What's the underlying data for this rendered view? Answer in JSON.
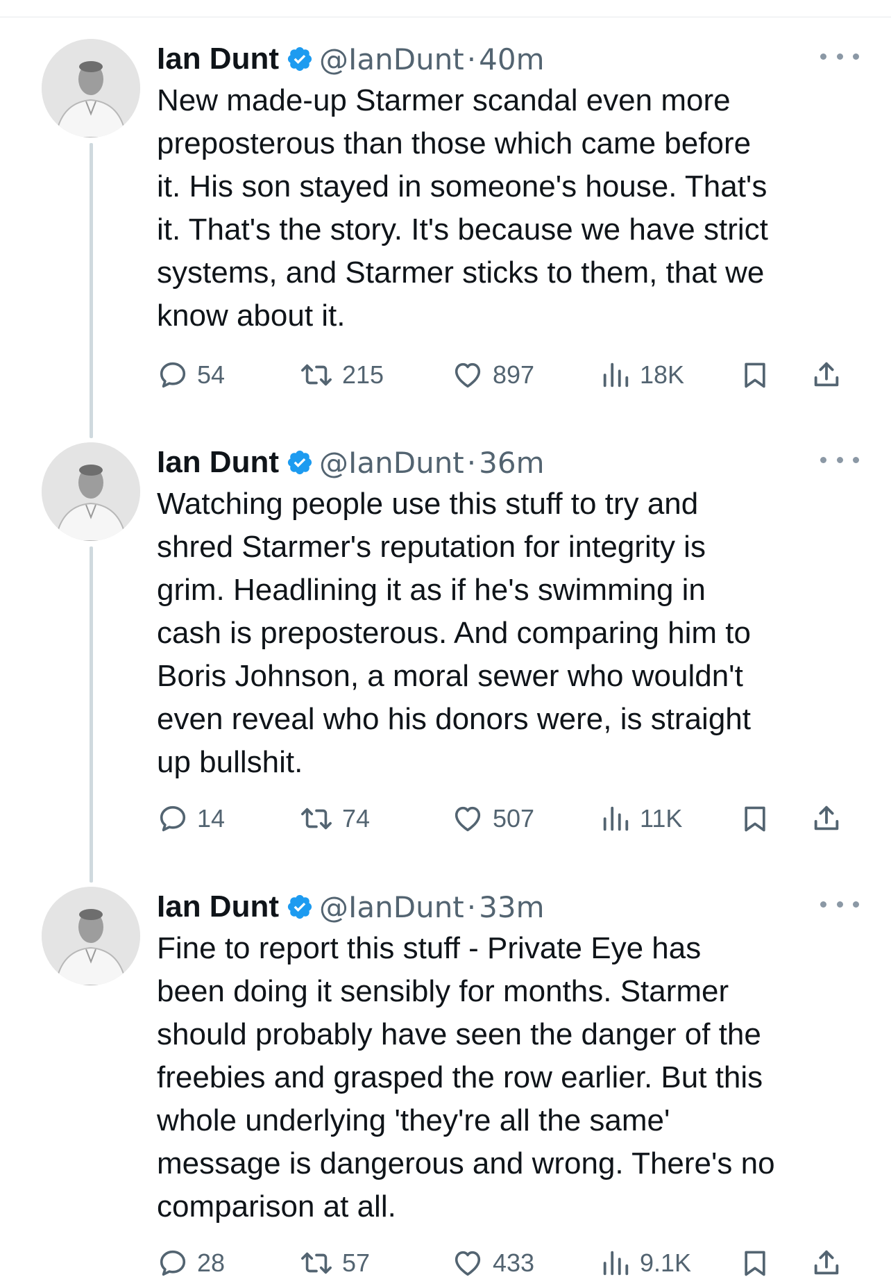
{
  "tweets": [
    {
      "name": "Ian Dunt",
      "handle": "@IanDunt",
      "separator": "·",
      "time": "40m",
      "text_lines": [
        "New made-up Starmer scandal even more",
        "preposterous than those which came before",
        "it. His son stayed in someone's house. That's",
        "it. That's the story. It's because we have strict",
        "systems, and Starmer sticks to them, that we",
        "know about it."
      ],
      "replies": "54",
      "reposts": "215",
      "likes": "897",
      "views": "18K"
    },
    {
      "name": "Ian Dunt",
      "handle": "@IanDunt",
      "separator": "·",
      "time": "36m",
      "text_lines": [
        "Watching people use this stuff to try and",
        "shred Starmer's reputation for integrity is",
        "grim. Headlining it as if he's swimming in",
        "cash is preposterous. And comparing him to",
        "Boris Johnson, a moral sewer who wouldn't",
        "even reveal who his donors were, is straight",
        "up bullshit."
      ],
      "replies": "14",
      "reposts": "74",
      "likes": "507",
      "views": "11K"
    },
    {
      "name": "Ian Dunt",
      "handle": "@IanDunt",
      "separator": "·",
      "time": "33m",
      "text_lines": [
        "Fine to report this stuff - Private Eye has",
        "been doing it sensibly for months. Starmer",
        "should probably have seen the danger of the",
        "freebies and grasped the row earlier. But this",
        "whole underlying 'they're all the same'",
        "message is dangerous and wrong. There's no",
        "comparison at all."
      ],
      "replies": "28",
      "reposts": "57",
      "likes": "433",
      "views": "9.1K"
    }
  ],
  "icons": {
    "verified": "verified-badge-icon",
    "more": "more-options-icon",
    "reply": "reply-icon",
    "repost": "repost-icon",
    "like": "like-icon",
    "views": "views-icon",
    "bookmark": "bookmark-icon",
    "share": "share-icon"
  },
  "colors": {
    "verified": "#1d9bf0",
    "muted": "#536471",
    "text": "#0f1419",
    "thread_line": "#cfd9de"
  }
}
